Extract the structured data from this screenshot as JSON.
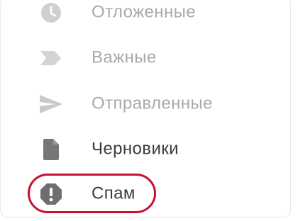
{
  "nav": {
    "items": [
      {
        "label": "Отложенные",
        "icon": "clock-icon"
      },
      {
        "label": "Важные",
        "icon": "important-label-icon"
      },
      {
        "label": "Отправленные",
        "icon": "send-icon"
      },
      {
        "label": "Черновики",
        "icon": "draft-icon"
      },
      {
        "label": "Спам",
        "icon": "spam-icon"
      }
    ]
  },
  "colors": {
    "muted_text": "#a9a9a9",
    "muted_icon": "#cfcfcf",
    "dark_text": "#3b3b3b",
    "dark_icon": "#707070",
    "highlight": "#c8102e"
  }
}
